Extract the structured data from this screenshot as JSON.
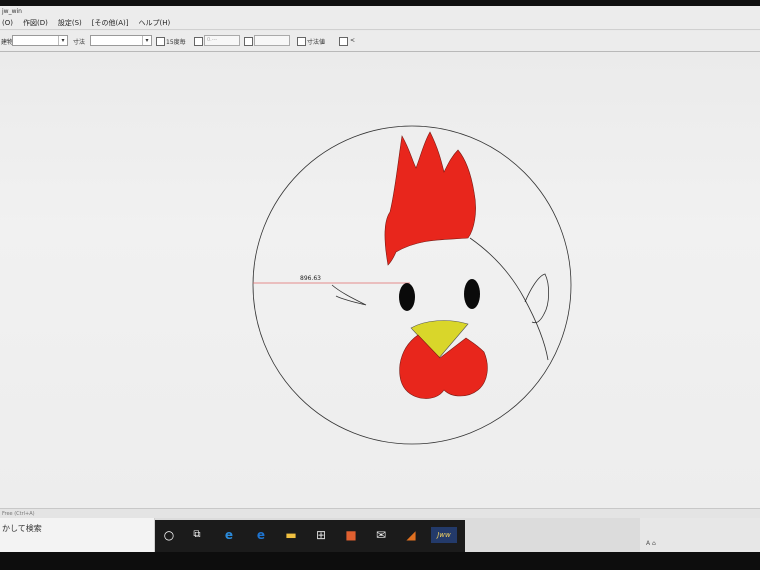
{
  "window": {
    "title": "jw_win"
  },
  "menu": {
    "items": [
      "(O)",
      "作図(D)",
      "設定(S)",
      "[その他(A)]",
      "ヘルプ(H)"
    ]
  },
  "toolbar": {
    "layer_label": "建物",
    "dimension_label": "寸法",
    "check_15_label": "15度毎",
    "radius_placeholder": "0.---",
    "dimension_value_label": "寸法値",
    "angle_label": "<"
  },
  "drawing": {
    "dimension_text": "896.63",
    "colors": {
      "comb": "#e8261c",
      "beak": "#d9d62a",
      "wattle": "#e8261c",
      "eye": "#0a0a0a",
      "outline": "#333333",
      "dimension_line": "#e06a6a"
    }
  },
  "statusbar": {
    "text": "Free (Ctrl+A)"
  },
  "taskbar": {
    "search_text": "かして検索",
    "icons": [
      "cortana-icon",
      "task-view-icon",
      "edge-icon",
      "ie-icon",
      "file-explorer-icon",
      "store-icon",
      "media-icon",
      "mail-icon",
      "matlab-icon",
      "jww-icon"
    ],
    "jww_label": "Jww",
    "tray_text": "A ⌂"
  }
}
